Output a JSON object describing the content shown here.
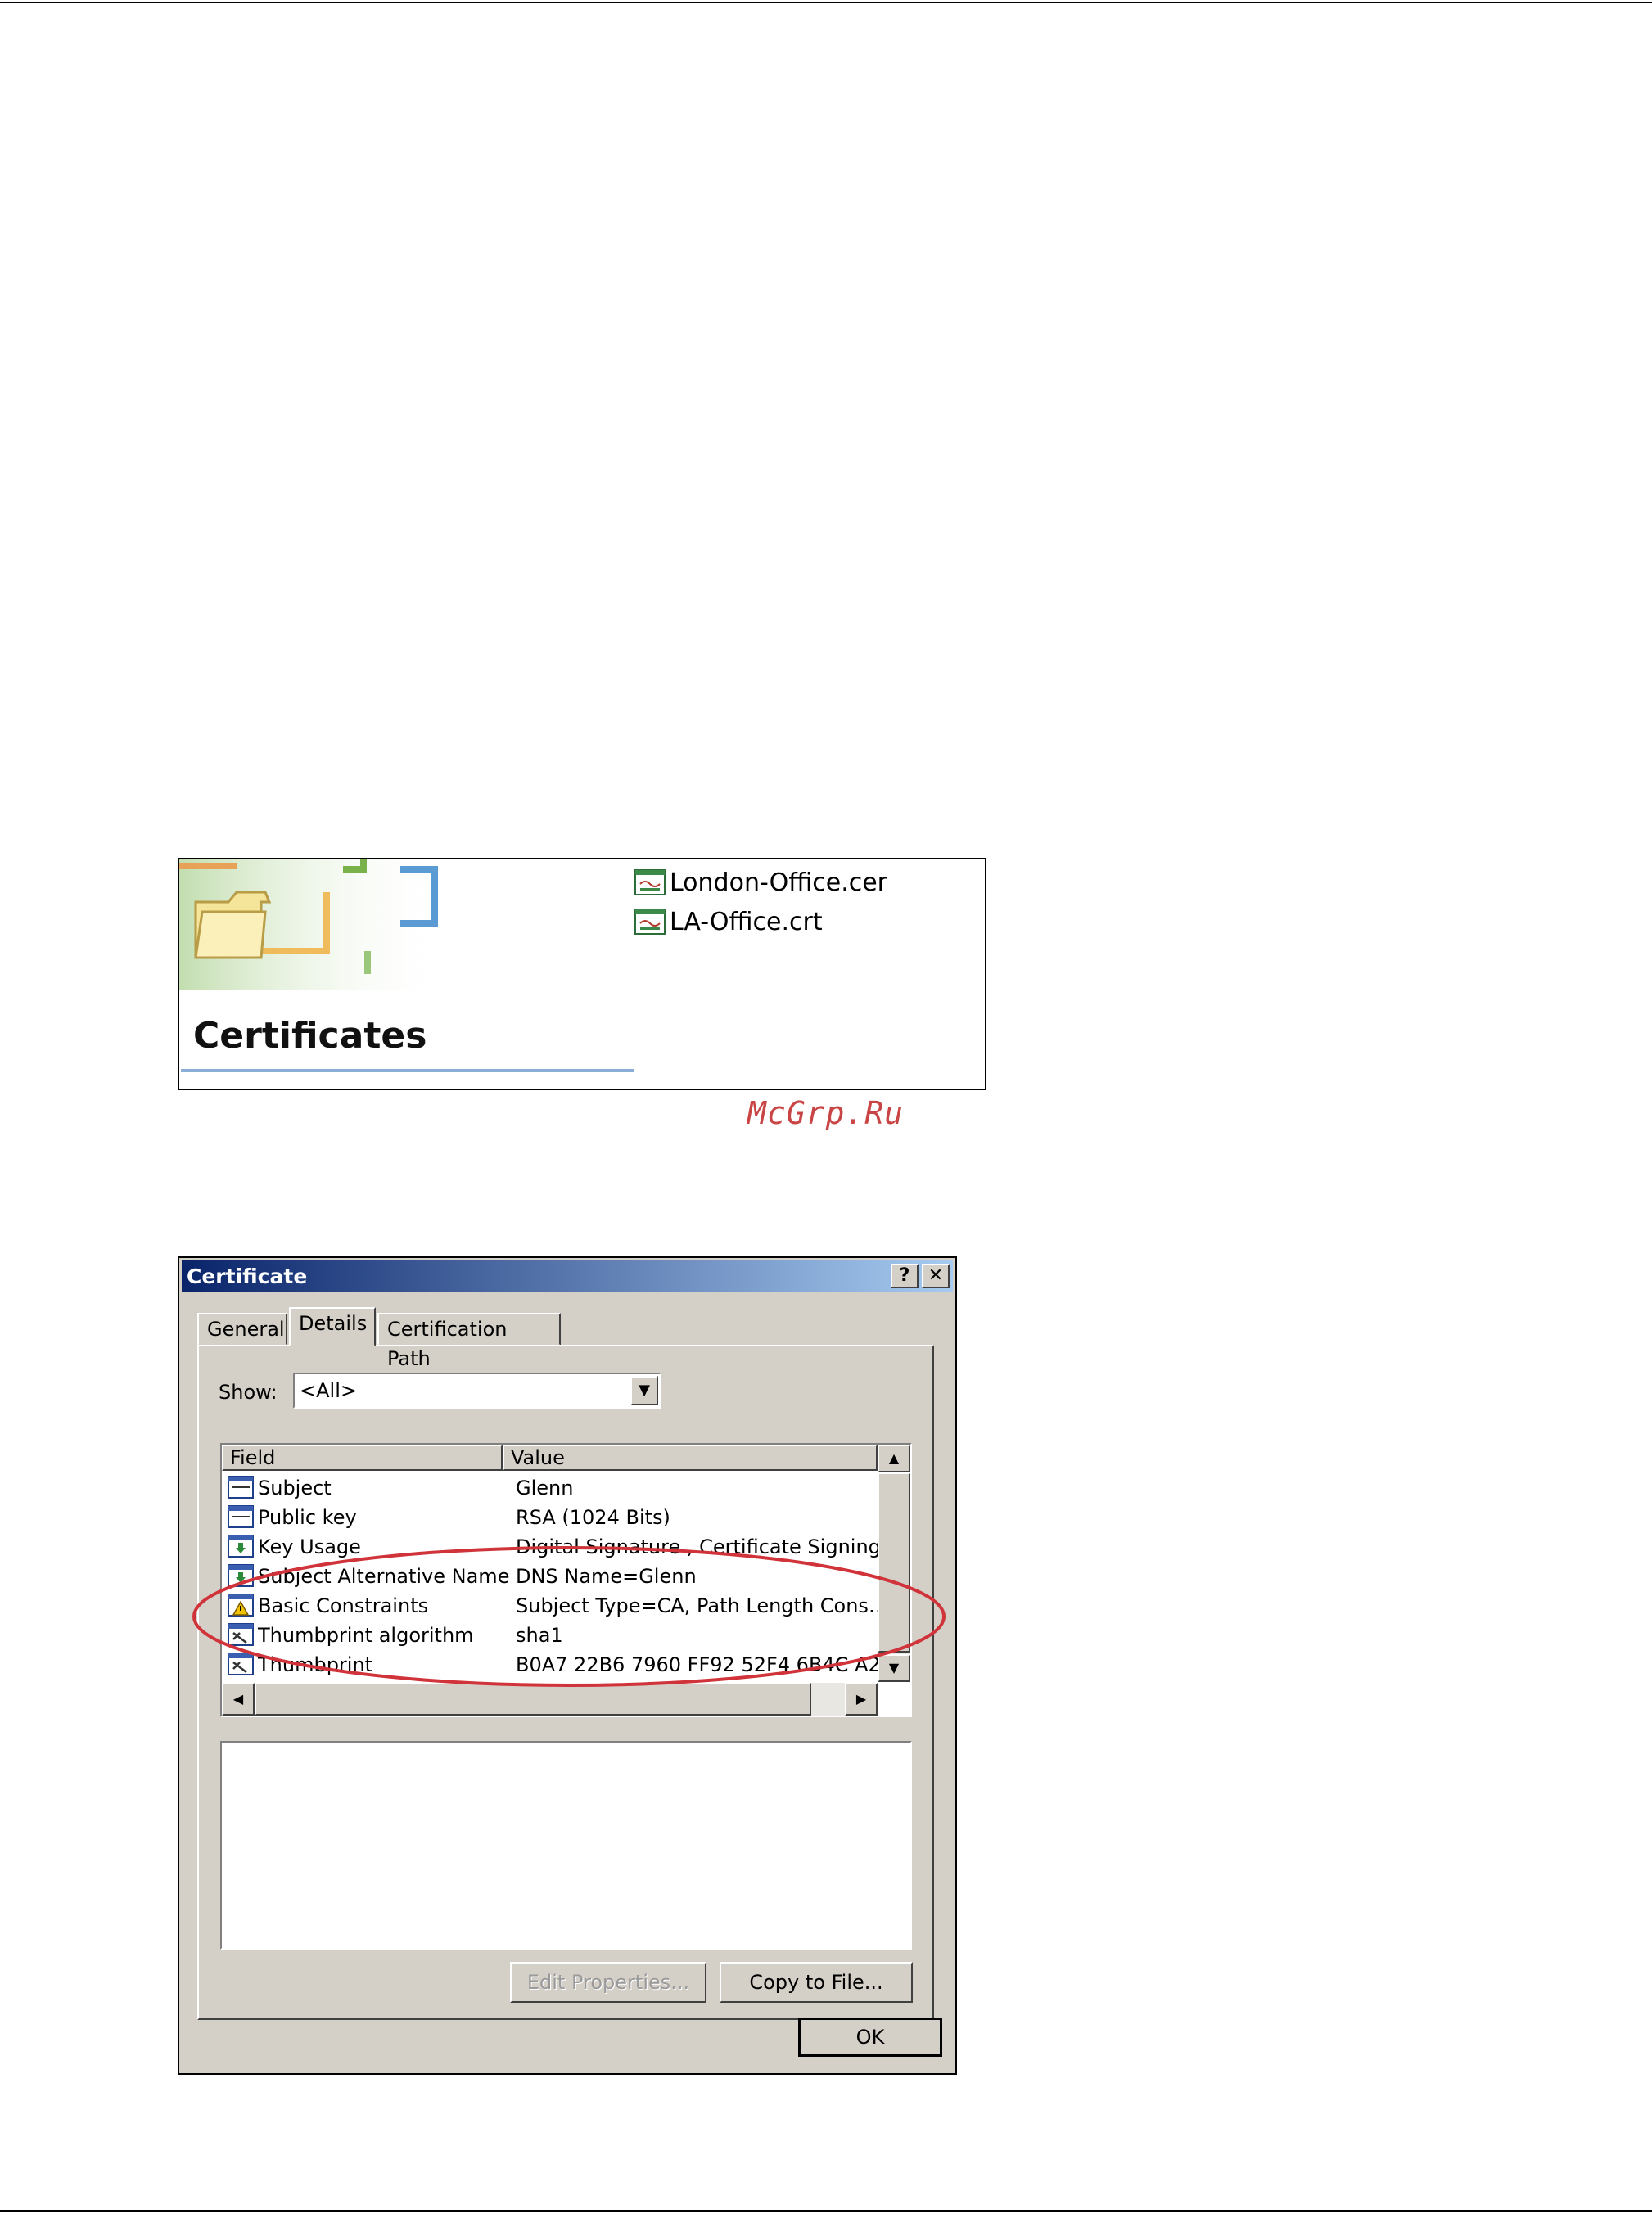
{
  "explorer": {
    "folder_title": "Certificates",
    "files": [
      {
        "name": "London-Office.cer",
        "icon": "certificate-file-icon"
      },
      {
        "name": "LA-Office.crt",
        "icon": "certificate-file-icon"
      }
    ]
  },
  "watermark": "McGrp.Ru",
  "dialog": {
    "title": "Certificate",
    "help_label": "?",
    "close_label": "✕",
    "tabs": [
      {
        "label": "General",
        "active": false
      },
      {
        "label": "Details",
        "active": true
      },
      {
        "label": "Certification Path",
        "active": false
      }
    ],
    "show": {
      "label": "Show:",
      "value": "<All>"
    },
    "list": {
      "headers": {
        "field": "Field",
        "value": "Value"
      },
      "rows": [
        {
          "field": "Subject",
          "value": "Glenn",
          "icon": "field-icon"
        },
        {
          "field": "Public key",
          "value": "RSA (1024 Bits)",
          "icon": "field-icon"
        },
        {
          "field": "Key Usage",
          "value": "Digital Signature , Certificate Signing(…",
          "icon": "extension-icon"
        },
        {
          "field": "Subject Alternative Name",
          "value": "DNS Name=Glenn",
          "icon": "extension-icon"
        },
        {
          "field": "Basic Constraints",
          "value": "Subject Type=CA, Path Length Cons…",
          "icon": "critical-extension-icon"
        },
        {
          "field": "Thumbprint algorithm",
          "value": "sha1",
          "icon": "property-icon"
        },
        {
          "field": "Thumbprint",
          "value": "B0A7 22B6 7960 FF92 52F4 6B4C A2…",
          "icon": "property-icon"
        }
      ]
    },
    "buttons": {
      "edit_properties": "Edit Properties...",
      "copy_to_file": "Copy to File...",
      "ok": "OK"
    }
  },
  "colors": {
    "dialog_face": "#d4d0c8",
    "titlebar_start": "#0a246a",
    "titlebar_end": "#a6caf0",
    "highlight_ellipse": "#d0343a",
    "watermark": "#c94444"
  }
}
